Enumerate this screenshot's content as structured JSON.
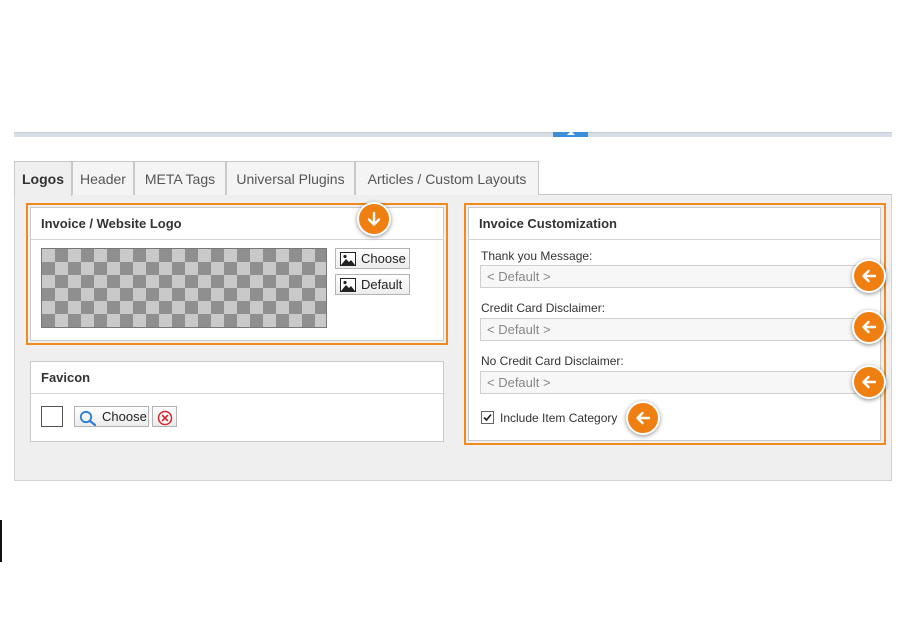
{
  "tabs": [
    {
      "label": "Logos",
      "active": true
    },
    {
      "label": "Header",
      "active": false
    },
    {
      "label": "META Tags",
      "active": false
    },
    {
      "label": "Universal Plugins",
      "active": false
    },
    {
      "label": "Articles / Custom Layouts",
      "active": false
    }
  ],
  "logo_section": {
    "title": "Invoice / Website Logo",
    "choose_label": "Choose",
    "default_label": "Default"
  },
  "favicon_section": {
    "title": "Favicon",
    "choose_label": "Choose"
  },
  "invoice_customization": {
    "title": "Invoice Customization",
    "fields": [
      {
        "label": "Thank you Message:",
        "value": "< Default >"
      },
      {
        "label": "Credit Card Disclaimer:",
        "value": "< Default >"
      },
      {
        "label": "No Credit Card Disclaimer:",
        "value": "< Default >"
      }
    ],
    "include_item_category": {
      "label": "Include Item Category",
      "checked": true
    }
  },
  "colors": {
    "highlight_orange": "#f08a1c",
    "accent_blue": "#3b8fd9"
  },
  "icons": {
    "arrow_down": "arrow-down-icon",
    "arrow_left": "arrow-left-icon",
    "image": "image-icon",
    "search": "search-icon",
    "remove": "remove-circle-icon"
  }
}
